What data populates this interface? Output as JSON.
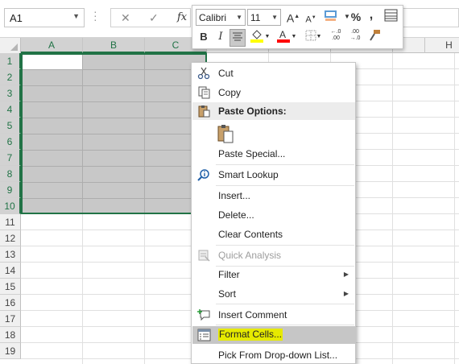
{
  "namebox": {
    "value": "A1"
  },
  "formula_bar": {
    "cancel": "✕",
    "enter": "✓",
    "fx": "fx"
  },
  "columns": [
    {
      "label": "A",
      "selected": true
    },
    {
      "label": "B",
      "selected": true
    },
    {
      "label": "C",
      "selected": true
    },
    {
      "label": "H",
      "selected": false
    }
  ],
  "rows": [
    "1",
    "2",
    "3",
    "4",
    "5",
    "6",
    "7",
    "8",
    "9",
    "10",
    "11",
    "12",
    "13",
    "14",
    "15",
    "16",
    "17",
    "18",
    "19"
  ],
  "selected_rows": 10,
  "mini_toolbar": {
    "font": "Calibri",
    "size": "11",
    "grow": "A",
    "shrink": "A",
    "percent": "%",
    "comma": ",",
    "bold": "B",
    "italic": "I",
    "fill_color": "#ffff00",
    "font_color": "#ff0000",
    "dec_increase": "←.0\n.00",
    "dec_decrease": ".00\n→.0"
  },
  "context_menu": {
    "items": [
      {
        "label": "Cut",
        "icon": "scissors-icon"
      },
      {
        "label": "Copy",
        "icon": "copy-icon"
      },
      {
        "label": "Paste Options:",
        "icon": "paste-icon",
        "header": true
      },
      {
        "label": "",
        "icon": "paste-option-icon"
      },
      {
        "label": "Paste Special...",
        "icon": ""
      },
      {
        "label": "Smart Lookup",
        "icon": "smart-lookup-icon"
      },
      {
        "label": "Insert...",
        "icon": ""
      },
      {
        "label": "Delete...",
        "icon": ""
      },
      {
        "label": "Clear Contents",
        "icon": ""
      },
      {
        "label": "Quick Analysis",
        "icon": "quick-analysis-icon",
        "disabled": true
      },
      {
        "label": "Filter",
        "icon": "",
        "submenu": true
      },
      {
        "label": "Sort",
        "icon": "",
        "submenu": true
      },
      {
        "label": "Insert Comment",
        "icon": "insert-comment-icon"
      },
      {
        "label": "Format Cells...",
        "icon": "format-cells-icon",
        "highlighted": true
      },
      {
        "label": "Pick From Drop-down List...",
        "icon": ""
      }
    ]
  }
}
